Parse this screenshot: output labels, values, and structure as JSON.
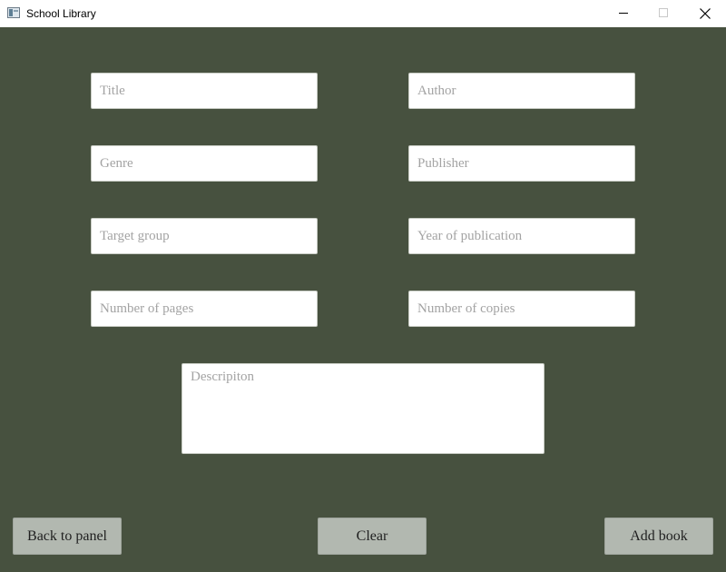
{
  "window": {
    "title": "School Library",
    "icon": "app-window-icon",
    "controls": {
      "minimize_icon": "minimize-icon",
      "maximize_icon": "maximize-icon",
      "close_icon": "close-icon"
    }
  },
  "colors": {
    "background": "#47513f",
    "field_background": "#ffffff",
    "placeholder": "#a3a3a3",
    "button_background": "#b2b8b0"
  },
  "form": {
    "title": {
      "value": "",
      "placeholder": "Title"
    },
    "author": {
      "value": "",
      "placeholder": "Author"
    },
    "genre": {
      "value": "",
      "placeholder": "Genre"
    },
    "publisher": {
      "value": "",
      "placeholder": "Publisher"
    },
    "target_group": {
      "value": "",
      "placeholder": "Target group"
    },
    "year_of_publication": {
      "value": "",
      "placeholder": "Year of publication"
    },
    "number_of_pages": {
      "value": "",
      "placeholder": "Number of pages"
    },
    "number_of_copies": {
      "value": "",
      "placeholder": "Number of copies"
    },
    "description": {
      "value": "",
      "placeholder": "Descripiton"
    }
  },
  "buttons": {
    "back": "Back to panel",
    "clear": "Clear",
    "add": "Add book"
  }
}
